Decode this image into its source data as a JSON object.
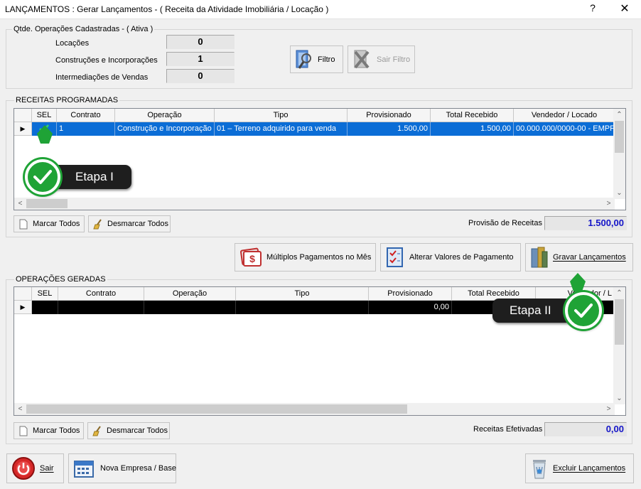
{
  "window": {
    "title": "LANÇAMENTOS : Gerar Lançamentos - ( Receita da Atividade Imobiliária / Locação )",
    "help": "?",
    "close": "✕"
  },
  "counts": {
    "group_label": "Qtde. Operações Cadastradas - ( Ativa )",
    "rows": [
      {
        "label": "Locações",
        "value": "0"
      },
      {
        "label": "Construções e Incorporações",
        "value": "1"
      },
      {
        "label": "Intermediações de Vendas",
        "value": "0"
      }
    ],
    "filter_label": "Filtro",
    "exit_filter_label": "Sair Filtro"
  },
  "receitas": {
    "group_label": "RECEITAS PROGRAMADAS",
    "columns": [
      "SEL",
      "Contrato",
      "Operação",
      "Tipo",
      "Provisionado",
      "Total Recebido",
      "Vendedor / Locado"
    ],
    "rows": [
      {
        "contrato": "1",
        "operacao": "Construção e Incorporação",
        "tipo": "01 – Terreno adquirido para venda",
        "provisionado": "1.500,00",
        "total_recebido": "1.500,00",
        "vendedor": "00.000.000/0000-00 - EMPF"
      }
    ],
    "marcar_label": "Marcar Todos",
    "desmarcar_label": "Desmarcar Todos",
    "total_label": "Provisão de Receitas",
    "total_value": "1.500,00"
  },
  "actions": {
    "multiplos_label": "Múltiplos Pagamentos no Mês",
    "alterar_label": "Alterar Valores de Pagamento",
    "gravar_label": "Gravar Lançamentos"
  },
  "operacoes": {
    "group_label": "OPERAÇÕES GERADAS",
    "columns": [
      "SEL",
      "Contrato",
      "Operação",
      "Tipo",
      "Provisionado",
      "Total Recebido",
      "Vendedor / L"
    ],
    "rows": [
      {
        "provisionado": "0,00"
      }
    ],
    "marcar_label": "Marcar Todos",
    "desmarcar_label": "Desmarcar Todos",
    "total_label": "Receitas Efetivadas",
    "total_value": "0,00"
  },
  "footer": {
    "sair_label": "Sair",
    "nova_empresa_label": "Nova Empresa / Base",
    "excluir_label": "Excluir Lançamentos"
  },
  "callouts": {
    "step1": "Etapa I",
    "step2": "Etapa II"
  },
  "colors": {
    "selected_row": "#0b6dd6",
    "active_row": "#000000",
    "total_value": "#1414c8",
    "callout_green": "#1fa336",
    "callout_dark": "#1e1e1e"
  }
}
